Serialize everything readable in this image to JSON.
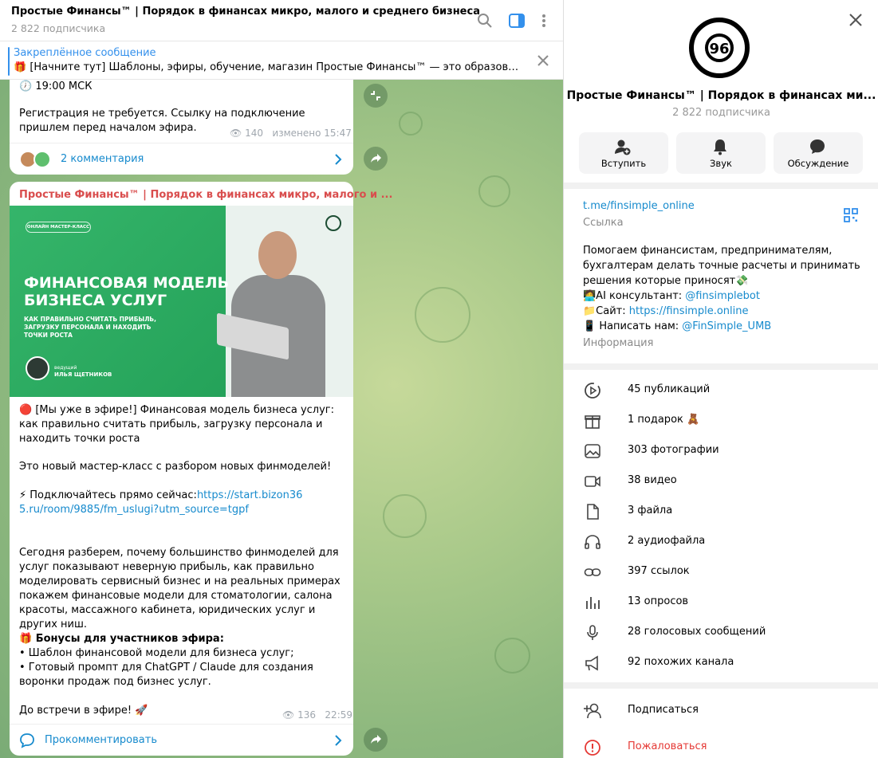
{
  "chat": {
    "title": "Простые Финансы™ | Порядок в финансах микро, малого и среднего бизнеса",
    "subscribers": "2 822 подписчика",
    "pinned": {
      "title": "Закреплённое сообщение",
      "text": "🎁 [Начните тут] Шаблоны, эфиры, обучение, магазин  Простые Финансы™ — это образовательно..."
    },
    "msg1": {
      "time_line": "🕖 19:00 МСК",
      "body": "Регистрация не требуется. Ссылку на подключение пришлем перед началом эфира.",
      "views": "140",
      "edited": "изменено 15:47",
      "comments": "2 комментария"
    },
    "msg2": {
      "author": "Простые Финансы™ | Порядок в финансах микро, малого и ...",
      "banner": {
        "badge": "ОНЛАЙН МАСТЕР-КЛАСС",
        "headline1": "ФИНАНСОВАЯ МОДЕЛЬ",
        "headline2": "БИЗНЕСА УСЛУГ",
        "subline": "КАК ПРАВИЛЬНО СЧИТАТЬ ПРИБЫЛЬ, ЗАГРУЗКУ ПЕРСОНАЛА И НАХОДИТЬ ТОЧКИ РОСТА",
        "host_label": "ведущий",
        "host_name": "ИЛЬЯ ЩЕТНИКОВ"
      },
      "p1": "🔴 [Мы уже в эфире!] Финансовая модель бизнеса услуг: как правильно считать прибыль, загрузку персонала и находить точки роста",
      "p2": "Это новый мастер-класс с разбором новых финмоделей!",
      "p3_prefix": "⚡ Подключайтесь прямо сейчас:",
      "p3_link": "https://start.bizon365.ru/room/9885/fm_uslugi?utm_source=tgpf",
      "p4": "Сегодня разберем, почему большинство финмоделей для услуг показывают неверную прибыль, как правильно моделировать сервисный бизнес и на реальных примерах покажем финансовые модели для стоматологии, салона красоты, массажного кабинета, юридических услуг и других ниш.",
      "p5_title": "🎁 Бонусы для участников эфира:",
      "p5_item1": "• Шаблон финансовой модели для бизнеса услуг;",
      "p5_item2": "• Готовый промпт для ChatGPT / Claude для создания воронки продаж под бизнес услуг.",
      "p6": "До встречи в эфире! 🚀",
      "views": "136",
      "time": "22:59",
      "comment_cta": "Прокомментировать"
    }
  },
  "panel": {
    "name": "Простые Финансы™ | Порядок в финансах ми...",
    "subscribers": "2 822 подписчика",
    "actions": [
      {
        "label": "Вступить",
        "icon": "add-user-icon"
      },
      {
        "label": "Звук",
        "icon": "bell-icon"
      },
      {
        "label": "Обсуждение",
        "icon": "chat-bubble-icon"
      }
    ],
    "link": "t.me/finsimple_online",
    "link_caption": "Ссылка",
    "about_line1": "Помогаем финансистам, предпринимателям,",
    "about_line2": "бухгалтерам делать точные расчеты и принимать",
    "about_line3": "решения которые приносят💸",
    "ai_prefix": "🧑‍💻AI консультант: ",
    "ai_link": "@finsimplebot",
    "site_prefix": "📁Сайт: ",
    "site_link": "https://finsimple.online",
    "write_prefix": "📱 Написать нам: ",
    "write_link": "@FinSimple_UMB",
    "info_caption": "Информация",
    "counts": [
      {
        "label": "45 публикаций",
        "icon": "play-circle-icon"
      },
      {
        "label": "1 подарок 🧸",
        "icon": "gift-icon"
      },
      {
        "label": "303 фотографии",
        "icon": "photo-icon"
      },
      {
        "label": "38 видео",
        "icon": "video-icon"
      },
      {
        "label": "3 файла",
        "icon": "file-icon"
      },
      {
        "label": "2 аудиофайла",
        "icon": "headphones-icon"
      },
      {
        "label": "397 ссылок",
        "icon": "link-icon"
      },
      {
        "label": "13 опросов",
        "icon": "poll-icon"
      },
      {
        "label": "28 голосовых сообщений",
        "icon": "microphone-icon"
      },
      {
        "label": "92 похожих канала",
        "icon": "megaphone-icon"
      }
    ],
    "subscribe": "Подписаться",
    "report": "Пожаловаться"
  },
  "colors": {
    "accent": "#3390ec",
    "link": "#168acd",
    "author": "#d94d4d",
    "report": "#e53935"
  }
}
